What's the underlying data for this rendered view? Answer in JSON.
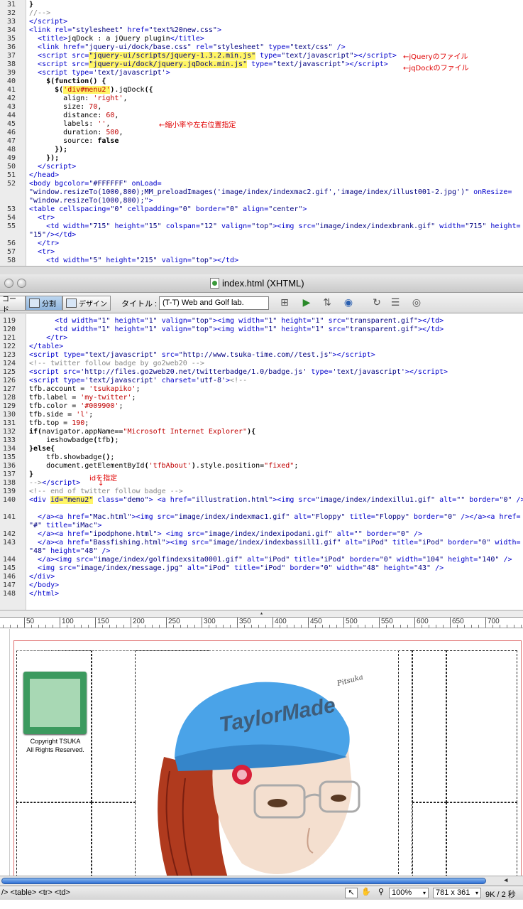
{
  "top_code": {
    "lines": [
      {
        "n": "31",
        "html": "<span class=\"k\">}</span>"
      },
      {
        "n": "32",
        "html": "<span class=\"c\">//--&gt;</span>"
      },
      {
        "n": "33",
        "html": "<span class=\"t\">&lt;/script&gt;</span>"
      },
      {
        "n": "34",
        "html": "<span class=\"t\">&lt;link</span> <span class=\"a\">rel=</span><span class=\"s\">\"stylesheet\"</span> <span class=\"a\">href=</span><span class=\"s\">\"text%20new.css\"</span><span class=\"t\">&gt;</span>"
      },
      {
        "n": "35",
        "html": "  <span class=\"t\">&lt;title&gt;</span>jqDock : a jQuery plugin<span class=\"t\">&lt;/title&gt;</span>"
      },
      {
        "n": "36",
        "html": "  <span class=\"t\">&lt;link</span> <span class=\"a\">href=</span><span class=\"s\">\"jquery-ui/dock/base.css\"</span> <span class=\"a\">rel=</span><span class=\"s\">\"stylesheet\"</span> <span class=\"a\">type=</span><span class=\"s\">\"text/css\"</span> <span class=\"t\">/&gt;</span>"
      },
      {
        "n": "37",
        "html": "  <span class=\"t\">&lt;script</span> <span class=\"a\">src=</span><span class=\"s hl\">\"jquery-ui/scripts/jquery-1.3.2.min.js\"</span> <span class=\"a\">type=</span><span class=\"s\">\"text/javascript\"</span><span class=\"t\">&gt;&lt;/script&gt;</span>"
      },
      {
        "n": "38",
        "html": "  <span class=\"t\">&lt;script</span> <span class=\"a\">src=</span><span class=\"s hl\">\"jquery-ui/dock/jquery.jqDock.min.js\"</span> <span class=\"a\">type=</span><span class=\"s\">\"text/javascript\"</span><span class=\"t\">&gt;&lt;/script&gt;</span>"
      },
      {
        "n": "39",
        "html": "  <span class=\"t\">&lt;script</span> <span class=\"a\">type=</span><span class=\"s\">'text/javascript'</span><span class=\"t\">&gt;</span>"
      },
      {
        "n": "40",
        "html": "    <span class=\"k\">$(function() {</span>"
      },
      {
        "n": "41",
        "html": "      <span class=\"k\">$(</span><span class=\"v hl\">'div#menu2'</span><span class=\"k\">)</span>.jqDock<span class=\"k\">({</span>"
      },
      {
        "n": "42",
        "html": "        align: <span class=\"v\">'right'</span>,"
      },
      {
        "n": "43",
        "html": "        size: <span class=\"v\">70</span>,"
      },
      {
        "n": "44",
        "html": "        distance: <span class=\"v\">60</span>,"
      },
      {
        "n": "45",
        "html": "        labels: <span class=\"v\">''</span>,"
      },
      {
        "n": "46",
        "html": "        duration: <span class=\"v\">500</span>,"
      },
      {
        "n": "47",
        "html": "        source: <span class=\"k\">false</span>"
      },
      {
        "n": "48",
        "html": "      <span class=\"k\">});</span>"
      },
      {
        "n": "49",
        "html": "    <span class=\"k\">});</span>"
      },
      {
        "n": "50",
        "html": "  <span class=\"t\">&lt;/script&gt;</span>"
      },
      {
        "n": "51",
        "html": "<span class=\"t\">&lt;/head&gt;</span>"
      },
      {
        "n": "52",
        "html": "<span class=\"t\">&lt;body</span> <span class=\"a\">bgcolor=</span><span class=\"s\">\"#FFFFFF\"</span> <span class=\"a\">onLoad=</span>"
      },
      {
        "n": "",
        "html": "<span class=\"s\">\"window.resizeTo(1000,800);MM_preloadImages('image/index/indexmac2.gif','image/index/illust001-2.jpg')\"</span> <span class=\"a\">onResize=</span>"
      },
      {
        "n": "",
        "html": "<span class=\"s\">\"window.resizeTo(1000,800);\"</span><span class=\"t\">&gt;</span>"
      },
      {
        "n": "53",
        "html": "<span class=\"t\">&lt;table</span> <span class=\"a\">cellspacing=</span><span class=\"s\">\"0\"</span> <span class=\"a\">cellpadding=</span><span class=\"s\">\"0\"</span> <span class=\"a\">border=</span><span class=\"s\">\"0\"</span> <span class=\"a\">align=</span><span class=\"s\">\"center\"</span><span class=\"t\">&gt;</span>"
      },
      {
        "n": "54",
        "html": "  <span class=\"t\">&lt;tr&gt;</span>"
      },
      {
        "n": "55",
        "html": "    <span class=\"t\">&lt;td</span> <span class=\"a\">width=</span><span class=\"s\">\"715\"</span> <span class=\"a\">height=</span><span class=\"s\">\"15\"</span> <span class=\"a\">colspan=</span><span class=\"s\">\"12\"</span> <span class=\"a\">valign=</span><span class=\"s\">\"top\"</span><span class=\"t\">&gt;&lt;img</span> <span class=\"a\">src=</span><span class=\"s\">\"image/index/indexbrank.gif\"</span> <span class=\"a\">width=</span><span class=\"s\">\"715\"</span> <span class=\"a\">height=</span>"
      },
      {
        "n": "",
        "html": "<span class=\"s\">\"15\"</span><span class=\"t\">/&gt;&lt;/td&gt;</span>"
      },
      {
        "n": "56",
        "html": "  <span class=\"t\">&lt;/tr&gt;</span>"
      },
      {
        "n": "57",
        "html": "  <span class=\"t\">&lt;tr&gt;</span>"
      },
      {
        "n": "58",
        "html": "    <span class=\"t\">&lt;td</span> <span class=\"a\">width=</span><span class=\"s\">\"5\"</span> <span class=\"a\">height=</span><span class=\"s\">\"215\"</span> <span class=\"a\">valign=</span><span class=\"s\">\"top\"</span><span class=\"t\">&gt;&lt;/td&gt;</span>"
      }
    ],
    "annotations": [
      "←jQueryのファイル",
      "←jqDockのファイル",
      "←縮小率や左右位置指定"
    ]
  },
  "window": {
    "title": "index.html (XHTML)"
  },
  "toolbar": {
    "code_label": "コード",
    "split_label": "分割",
    "design_label": "デザイン",
    "title_label": "タイトル :",
    "title_value": "(T-T) Web and Golf lab."
  },
  "bottom_code": {
    "lines": [
      {
        "n": "119",
        "html": "      <span class=\"t\">&lt;td</span> <span class=\"a\">width=</span><span class=\"s\">\"1\"</span> <span class=\"a\">height=</span><span class=\"s\">\"1\"</span> <span class=\"a\">valign=</span><span class=\"s\">\"top\"</span><span class=\"t\">&gt;&lt;img</span> <span class=\"a\">width=</span><span class=\"s\">\"1\"</span> <span class=\"a\">height=</span><span class=\"s\">\"1\"</span> <span class=\"a\">src=</span><span class=\"s\">\"transparent.gif\"</span><span class=\"t\">&gt;&lt;/td&gt;</span>"
      },
      {
        "n": "120",
        "html": "      <span class=\"t\">&lt;td</span> <span class=\"a\">width=</span><span class=\"s\">\"1\"</span> <span class=\"a\">height=</span><span class=\"s\">\"1\"</span> <span class=\"a\">valign=</span><span class=\"s\">\"top\"</span><span class=\"t\">&gt;&lt;img</span> <span class=\"a\">width=</span><span class=\"s\">\"1\"</span> <span class=\"a\">height=</span><span class=\"s\">\"1\"</span> <span class=\"a\">src=</span><span class=\"s\">\"transparent.gif\"</span><span class=\"t\">&gt;&lt;/td&gt;</span>"
      },
      {
        "n": "121",
        "html": "    <span class=\"t\">&lt;/tr&gt;</span>"
      },
      {
        "n": "122",
        "html": "<span class=\"t\">&lt;/table&gt;</span>"
      },
      {
        "n": "123",
        "html": "<span class=\"t\">&lt;script</span> <span class=\"a\">type=</span><span class=\"s\">\"text/javascript\"</span> <span class=\"a\">src=</span><span class=\"s\">\"http://www.tsuka-time.com//test.js\"</span><span class=\"t\">&gt;&lt;/script&gt;</span>"
      },
      {
        "n": "124",
        "html": "<span class=\"c\">&lt;!-- twitter follow badge by go2web20 --&gt;</span>"
      },
      {
        "n": "125",
        "html": "<span class=\"t\">&lt;script</span> <span class=\"a\">src=</span><span class=\"s\">'http://files.go2web20.net/twitterbadge/1.0/badge.js'</span> <span class=\"a\">type=</span><span class=\"s\">'text/javascript'</span><span class=\"t\">&gt;&lt;/script&gt;</span>"
      },
      {
        "n": "126",
        "html": "<span class=\"t\">&lt;script</span> <span class=\"a\">type=</span><span class=\"s\">'text/javascript'</span> <span class=\"a\">charset=</span><span class=\"s\">'utf-8'</span><span class=\"t\">&gt;</span><span class=\"c\">&lt;!--</span>"
      },
      {
        "n": "127",
        "html": "tfb.account = <span class=\"v\">'tsukapiko'</span>;"
      },
      {
        "n": "128",
        "html": "tfb.label = <span class=\"v\">'my-twitter'</span>;"
      },
      {
        "n": "129",
        "html": "tfb.color = <span class=\"v\">'#009900'</span>;"
      },
      {
        "n": "130",
        "html": "tfb.side = <span class=\"v\">'l'</span>;"
      },
      {
        "n": "131",
        "html": "tfb.top = <span class=\"v\">190</span>;"
      },
      {
        "n": "132",
        "html": "<span class=\"k\">if(</span>navigator.appName==<span class=\"v\">\"Microsoft Internet Explorer\"</span><span class=\"k\">){</span>"
      },
      {
        "n": "133",
        "html": "    ieshowbadge<span class=\"k\">(</span>tfb<span class=\"k\">)</span>;"
      },
      {
        "n": "134",
        "html": "<span class=\"k\">}else{</span>"
      },
      {
        "n": "135",
        "html": "    tfb.showbadge<span class=\"k\">()</span>;"
      },
      {
        "n": "136",
        "html": "    document.getElementById<span class=\"k\">(</span><span class=\"v\">'tfbAbout'</span><span class=\"k\">)</span>.style.position=<span class=\"v\">\"fixed\"</span>;"
      },
      {
        "n": "137",
        "html": "<span class=\"k\">}</span>"
      },
      {
        "n": "138",
        "html": "<span class=\"c\">--&gt;</span><span class=\"t\">&lt;/script&gt;</span>"
      },
      {
        "n": "139",
        "html": "<span class=\"c\">&lt;!-- end of twitter follow badge --&gt;</span>"
      },
      {
        "n": "140",
        "html": "<span class=\"t\">&lt;div</span> <span class=\"a hl\">id=</span><span class=\"s hl\">\"menu2\"</span> <span class=\"a\">class=</span><span class=\"s\">\"demo\"</span><span class=\"t\">&gt;</span> <span class=\"t\">&lt;a</span> <span class=\"a\">href=</span><span class=\"s\">\"illustration.html\"</span><span class=\"t\">&gt;&lt;img</span> <span class=\"a\">src=</span><span class=\"s\">\"image/index/indexillu1.gif\"</span> <span class=\"a\">alt=</span><span class=\"s\">\"\"</span> <span class=\"a\">border=</span><span class=\"s\">\"0\"</span> <span class=\"t\">/&gt;</span>"
      },
      {
        "n": "",
        "html": ""
      },
      {
        "n": "141",
        "html": "  <span class=\"t\">&lt;/a&gt;&lt;a</span> <span class=\"a\">href=</span><span class=\"s\">\"Mac.html\"</span><span class=\"t\">&gt;&lt;img</span> <span class=\"a\">src=</span><span class=\"s\">\"image/index/indexmac1.gif\"</span> <span class=\"a\">alt=</span><span class=\"s\">\"Floppy\"</span> <span class=\"a\">title=</span><span class=\"s\">\"Floppy\"</span> <span class=\"a\">border=</span><span class=\"s\">\"0\"</span> <span class=\"t\">/&gt;&lt;/a&gt;&lt;a</span> <span class=\"a\">href=</span>"
      },
      {
        "n": "",
        "html": "<span class=\"s\">\"#\"</span> <span class=\"a\">title=</span><span class=\"s\">\"iMac\"</span><span class=\"t\">&gt;</span>"
      },
      {
        "n": "142",
        "html": "  <span class=\"t\">&lt;/a&gt;&lt;a</span> <span class=\"a\">href=</span><span class=\"s\">\"ipodphone.html\"</span><span class=\"t\">&gt;</span> <span class=\"t\">&lt;img</span> <span class=\"a\">src=</span><span class=\"s\">\"image/index/indexipodani.gif\"</span> <span class=\"a\">alt=</span><span class=\"s\">\"\"</span> <span class=\"a\">border=</span><span class=\"s\">\"0\"</span> <span class=\"t\">/&gt;</span>"
      },
      {
        "n": "143",
        "html": "  <span class=\"t\">&lt;/a&gt;&lt;a</span> <span class=\"a\">href=</span><span class=\"s\">\"Bassfishing.html\"</span><span class=\"t\">&gt;&lt;img</span> <span class=\"a\">src=</span><span class=\"s\">\"image/index/indexbassill1.gif\"</span> <span class=\"a\">alt=</span><span class=\"s\">\"iPod\"</span> <span class=\"a\">title=</span><span class=\"s\">\"iPod\"</span> <span class=\"a\">border=</span><span class=\"s\">\"0\"</span> <span class=\"a\">width=</span>"
      },
      {
        "n": "",
        "html": "<span class=\"s\">\"48\"</span> <span class=\"a\">height=</span><span class=\"s\">\"48\"</span> <span class=\"t\">/&gt;</span>"
      },
      {
        "n": "144",
        "html": "  <span class=\"t\">&lt;/a&gt;&lt;img</span> <span class=\"a\">src=</span><span class=\"s\">\"image/index/golfindexsita0001.gif\"</span> <span class=\"a\">alt=</span><span class=\"s\">\"iPod\"</span> <span class=\"a\">title=</span><span class=\"s\">\"iPod\"</span> <span class=\"a\">border=</span><span class=\"s\">\"0\"</span> <span class=\"a\">width=</span><span class=\"s\">\"104\"</span> <span class=\"a\">height=</span><span class=\"s\">\"140\"</span> <span class=\"t\">/&gt;</span>"
      },
      {
        "n": "145",
        "html": "  <span class=\"t\">&lt;img</span> <span class=\"a\">src=</span><span class=\"s\">\"image/index/message.jpg\"</span> <span class=\"a\">alt=</span><span class=\"s\">\"iPod\"</span> <span class=\"a\">title=</span><span class=\"s\">\"iPod\"</span> <span class=\"a\">border=</span><span class=\"s\">\"0\"</span> <span class=\"a\">width=</span><span class=\"s\">\"48\"</span> <span class=\"a\">height=</span><span class=\"s\">\"43\"</span> <span class=\"t\">/&gt;</span>"
      },
      {
        "n": "146",
        "html": "<span class=\"t\">&lt;/div&gt;</span>"
      },
      {
        "n": "147",
        "html": "<span class=\"t\">&lt;/body&gt;</span>"
      },
      {
        "n": "148",
        "html": "<span class=\"t\">&lt;/html&gt;</span>"
      }
    ],
    "annotation": "idを指定"
  },
  "ruler": {
    "labels": [
      "50",
      "100",
      "150",
      "200",
      "250",
      "300",
      "350",
      "400",
      "450",
      "500",
      "550",
      "600",
      "650",
      "700"
    ]
  },
  "design": {
    "copyright_line1": "Copyright TSUKA",
    "copyright_line2": "All Rights Reserved.",
    "cap_brand": "TaylorMade",
    "signature": "Pitsuka",
    "colors": {
      "badge": "#3c9a5f",
      "badge_inner": "#a8d8b4",
      "cap": "#4aa3e8",
      "hair": "#b03a1e"
    }
  },
  "status": {
    "tags": "/> <table> <tr> <td>",
    "zoom": "100%",
    "size": "781 x 361",
    "filesize": "9K / 2 秒"
  }
}
